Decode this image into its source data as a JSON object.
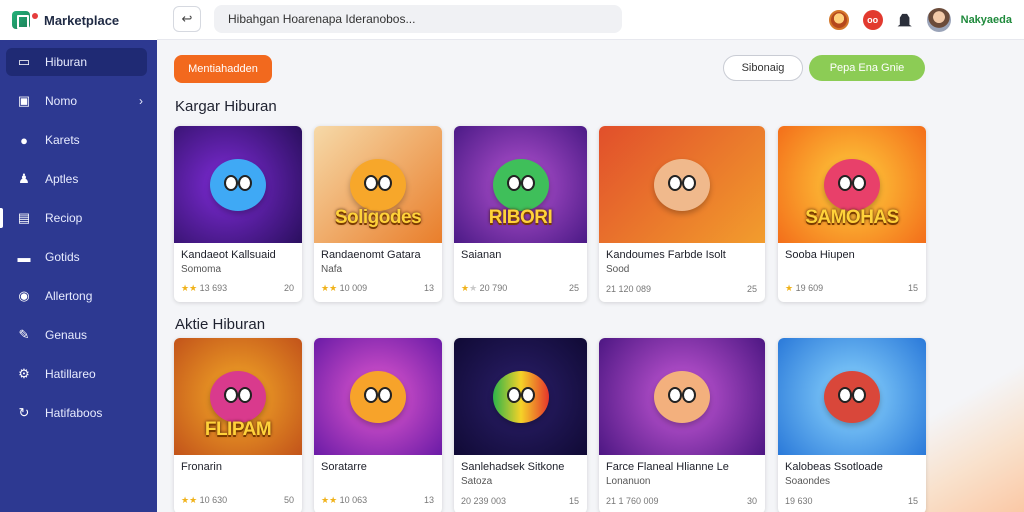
{
  "brand": {
    "name": "Marketplace"
  },
  "sidebar": {
    "items": [
      {
        "label": "Hiburan",
        "icon": "dashboard-icon",
        "glyph": "▭"
      },
      {
        "label": "Nomo",
        "icon": "image-icon",
        "glyph": "▣"
      },
      {
        "label": "Karets",
        "icon": "map-pin-icon",
        "glyph": "●"
      },
      {
        "label": "Aptles",
        "icon": "users-icon",
        "glyph": "♟"
      },
      {
        "label": "Reciop",
        "icon": "calendar-icon",
        "glyph": "▤"
      },
      {
        "label": "Gotids",
        "icon": "chat-icon",
        "glyph": "▬"
      },
      {
        "label": "Allertong",
        "icon": "gauge-icon",
        "glyph": "◉"
      },
      {
        "label": "Genaus",
        "icon": "pencil-icon",
        "glyph": "✎"
      },
      {
        "label": "Hatillareo",
        "icon": "settings-icon",
        "glyph": "⚙"
      },
      {
        "label": "Hatifaboos",
        "icon": "refresh-icon",
        "glyph": "↻"
      }
    ]
  },
  "topbar": {
    "search_text": "Hibahgan Hoarenapa Ideranobos...",
    "username": "Nakyaeda",
    "notification_label": "oo"
  },
  "actions": {
    "primary_label": "Mentiahadden",
    "secondary_label": "Sibonaig",
    "green_label": "Pepa Ena Gnie"
  },
  "sections": [
    {
      "title": "Kargar Hiburan",
      "cards": [
        {
          "logo": "",
          "title": "Kandaeot Kallsuaid",
          "subtitle": "Somoma",
          "rating": "13 693",
          "count": "20"
        },
        {
          "logo": "Soligodes",
          "title": "Randaenomt Gatara",
          "subtitle": "Nafa",
          "rating": "10 009",
          "count": "13"
        },
        {
          "logo": "RIBORI",
          "title": "Saianan",
          "subtitle": "",
          "rating": "20 790",
          "count": "25"
        },
        {
          "logo": "",
          "title": "Kandoumes Farbde Isolt",
          "subtitle": "Sood",
          "rating": "21 120 089",
          "count": "25"
        },
        {
          "logo": "SAMOHAS",
          "title": "Sooba Hiupen",
          "subtitle": "",
          "rating": "19 609",
          "count": "15"
        }
      ]
    },
    {
      "title": "Aktie Hiburan",
      "cards": [
        {
          "logo": "FLIPAM",
          "title": "Fronarin",
          "subtitle": "",
          "rating": "10 630",
          "count": "50"
        },
        {
          "logo": "",
          "title": "Soratarre",
          "subtitle": "",
          "rating": "10 063",
          "count": "13"
        },
        {
          "logo": "",
          "title": "Sanlehadsek Sitkone",
          "subtitle": "Satoza",
          "rating": "20 239 003",
          "count": "15"
        },
        {
          "logo": "",
          "title": "Farce Flaneal Hlianne Le",
          "subtitle": "Lonanuon",
          "rating": "21 1 760 009",
          "count": "30"
        },
        {
          "logo": "",
          "title": "Kalobeas Ssotloade",
          "subtitle": "Soaondes",
          "rating": "19 630",
          "count": "15"
        }
      ]
    }
  ]
}
